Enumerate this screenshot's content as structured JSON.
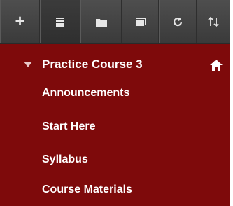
{
  "toolbar": {
    "buttons": [
      {
        "icon": "plus-icon",
        "label": "+"
      },
      {
        "icon": "list-icon"
      },
      {
        "icon": "folder-icon"
      },
      {
        "icon": "window-icon"
      },
      {
        "icon": "refresh-icon"
      },
      {
        "icon": "sort-icon"
      }
    ]
  },
  "course": {
    "title": "Practice Course 3",
    "expanded": true
  },
  "menu": {
    "items": [
      {
        "label": "Announcements"
      },
      {
        "label": "Start Here"
      },
      {
        "label": "Syllabus"
      },
      {
        "label": "Course Materials"
      }
    ]
  },
  "colors": {
    "panel_bg": "#7e0a0b",
    "toolbar_bg": "#444444",
    "text": "#ffffff"
  }
}
